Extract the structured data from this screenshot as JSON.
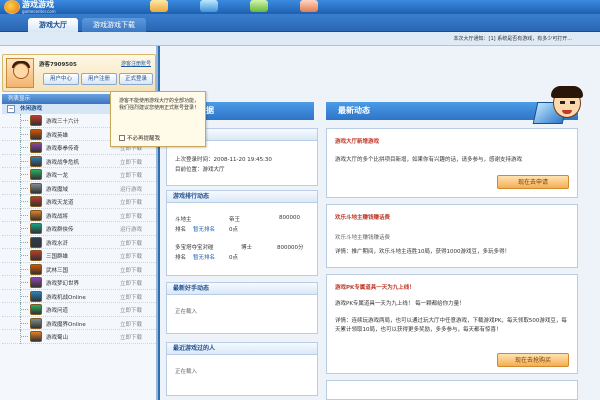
{
  "app": {
    "logo_text": "游戏游戏",
    "logo_sub": "gamecenter.com"
  },
  "tabs": [
    {
      "label": "游戏大厅"
    },
    {
      "label": "游戏游戏下载"
    }
  ],
  "infobar": {
    "text": "本次大厅通知：[1] 系统是否有游戏，有多少可打开..."
  },
  "user": {
    "name": "游客7909505",
    "link": "游客注册账号",
    "buttons": [
      "用户中心",
      "用户注册",
      "正式登录"
    ]
  },
  "sidebar": {
    "list_title": "列表显示",
    "category": "休闲游戏",
    "games": [
      {
        "name": "游戏三十六计",
        "status": "立即下载",
        "color": "#c0392b"
      },
      {
        "name": "游戏英雄",
        "status": "立即下载",
        "color": "#d35400"
      },
      {
        "name": "游戏泰拳传奇",
        "status": "立即下载",
        "color": "#8e44ad"
      },
      {
        "name": "游戏战争危机",
        "status": "立即下载",
        "color": "#2980b9"
      },
      {
        "name": "游戏一龙",
        "status": "立即下载",
        "color": "#27ae60"
      },
      {
        "name": "游戏魔域",
        "status": "运行游戏",
        "color": "#7f8c8d"
      },
      {
        "name": "游戏天龙道",
        "status": "立即下载",
        "color": "#c0392b"
      },
      {
        "name": "游戏战将",
        "status": "立即下载",
        "color": "#e67e22"
      },
      {
        "name": "游戏群侠传",
        "status": "运行游戏",
        "color": "#16a085"
      },
      {
        "name": "游戏水浒",
        "status": "立即下载",
        "color": "#2c3e50"
      },
      {
        "name": "三国群雄",
        "status": "立即下载",
        "color": "#c0392b"
      },
      {
        "name": "武林三国",
        "status": "立即下载",
        "color": "#d35400"
      },
      {
        "name": "游戏梦幻世界",
        "status": "立即下载",
        "color": "#8e44ad"
      },
      {
        "name": "游戏机战Online",
        "status": "立即下载",
        "color": "#2980b9"
      },
      {
        "name": "游戏问道",
        "status": "立即下载",
        "color": "#27ae60"
      },
      {
        "name": "游戏魔界Online",
        "status": "立即下载",
        "color": "#7f8c8d"
      },
      {
        "name": "游戏蜀山",
        "status": "立即下载",
        "color": "#e67e22"
      }
    ]
  },
  "popup": {
    "text": "游客不能使用游戏大厅的全部功能，我们强烈建议您使用正式账号登录！",
    "checkbox": "不必再提醒我"
  },
  "left_panel": {
    "banner": "游戏数据",
    "visitor_title": "游客",
    "last_login_label": "上次登录时间：2008-11-20 19:45:30",
    "last_login_place": "目前位置：游戏大厅",
    "ranking_title": "游戏排行动态",
    "rank1": {
      "game": "斗地主",
      "role": "帝王",
      "score": "800000"
    },
    "rank1_sub": {
      "label": "排名",
      "value": "暂无排名",
      "count": "0点"
    },
    "rank2": {
      "game": "多宝塔夺宝对碰",
      "role": "博士",
      "score": "800000分"
    },
    "rank2_sub": {
      "label": "排名",
      "value": "暂无排名",
      "count": "0点"
    },
    "recent_title": "最新好手动态",
    "recent_text": "正在载入",
    "lately_title": "最近游戏过的人",
    "lately_text": "正在载入"
  },
  "news": {
    "banner": "最新动态",
    "item1_title": "游戏大厅新增游戏",
    "item1_text": "游戏大厅的多个比拼项目新增，如果你有兴趣的话，请多参与，感谢支持游戏",
    "item1_btn": "现在去申请",
    "item2_title": "欢乐斗地主赚钱赚话费",
    "item2_text": "欢乐斗地主赚钱赚话费",
    "item2_desc": "详情：推广期间，欢乐斗地主连胜10局，获得1000游戏豆，多玩多得！",
    "item3_title": "游戏PK专属道具一天为九上线！",
    "item3_sub": "游戏PK专属道具一天为九上线！ 每一颗都给你力量！",
    "item3_desc": "详情：连续玩游戏两局，也可以通过玩大厅中任意游戏，下载游戏PK，每天领取500游戏豆，每天累计领取10局，也可以获得更多奖励，多多参与，每天都有惊喜！",
    "item3_btn": "现在去抢购买"
  }
}
